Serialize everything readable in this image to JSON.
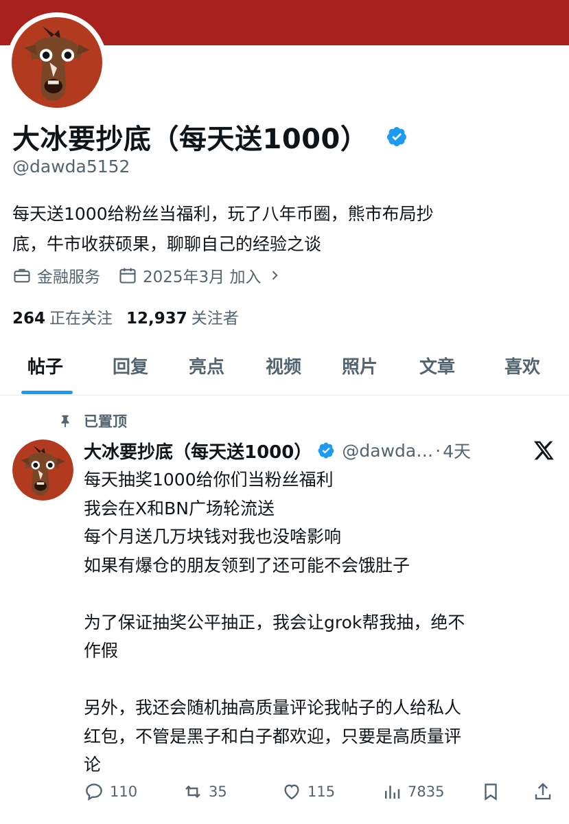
{
  "colors": {
    "banner": "#a8211d",
    "accent": "#1d9bf0",
    "text": "#0f1419",
    "muted": "#536471"
  },
  "profile": {
    "display_name": "大冰要抄底（每天送1000）",
    "handle": "@dawda5152",
    "bio_lines": [
      "每天送1000给粉丝当福利，玩了八年币圈，熊市布局抄",
      "底，牛市收获硕果，聊聊自己的经验之谈"
    ],
    "category": "金融服务",
    "joined": "2025年3月 加入",
    "following_count": "264",
    "following_label": "正在关注",
    "followers_count": "12,937",
    "followers_label": "关注者",
    "icons": [
      "horse-avatar",
      "verified-badge-icon",
      "briefcase-icon",
      "calendar-icon",
      "chevron-right-icon"
    ]
  },
  "tabs": [
    "帖子",
    "回复",
    "亮点",
    "视频",
    "照片",
    "文章",
    "喜欢"
  ],
  "active_tab": "帖子",
  "post": {
    "pinned_label": "已置顶",
    "author": "大冰要抄底（每天送1000）",
    "handle": "@dawda…",
    "dot": "·",
    "time": "4天",
    "lines": [
      "每天抽奖1000给你们当粉丝福利",
      "我会在X和BN广场轮流送",
      "每个月送几万块钱对我也没啥影响",
      "如果有爆仓的朋友领到了还可能不会饿肚子",
      "",
      "为了保证抽奖公平抽正，我会让grok帮我抽，绝不",
      "作假",
      "",
      "另外，我还会随机抽高质量评论我帖子的人给私人",
      "红包，不管是黑子和白子都欢迎，只要是高质量评",
      "论"
    ],
    "stats": {
      "replies": "110",
      "reposts": "35",
      "likes": "115",
      "views": "7835"
    },
    "icons": [
      "pin-icon",
      "x-logo-icon",
      "reply-icon",
      "repost-icon",
      "like-icon",
      "views-icon",
      "bookmark-icon",
      "share-icon"
    ]
  }
}
